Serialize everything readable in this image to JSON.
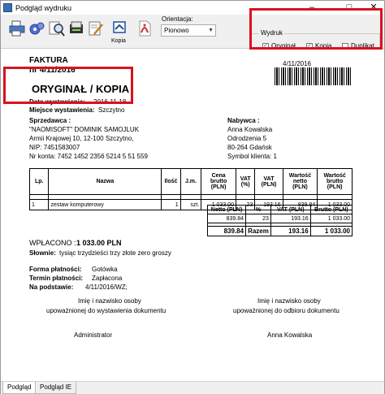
{
  "window": {
    "title": "Podgląd wydruku"
  },
  "toolbar": {
    "kopia_label": "Kopia",
    "orientation_label": "Orientacja:",
    "orientation_value": "Pionowo",
    "wydruk_legend": "Wydruk",
    "options": [
      {
        "label": "Oryginał",
        "checked": true
      },
      {
        "label": "Kopia",
        "checked": true
      },
      {
        "label": "Duplikat",
        "checked": false
      }
    ]
  },
  "invoice": {
    "doc_title": "FAKTURA",
    "number": "nr 4/11/2016",
    "barcode_text": "4/11/2016",
    "copy_type": "ORYGINAŁ / KOPIA",
    "issue_date_label": "Data wystawienia:",
    "issue_date_value": "2016-11-18",
    "place_label": "Miejsce wystawienia:",
    "place_value": "Szczytno",
    "seller_label": "Sprzedawca :",
    "seller_lines": [
      "\"NAOMISOFT\" DOMINIK SAMOJLUK",
      "Armii Krajowej 10, 12-100 Szczytno,",
      "NIP: 7451583007",
      "Nr konta: 7452 1452 2356 5214 5 51 559"
    ],
    "buyer_label": "Nabywca :",
    "buyer_lines": [
      "Anna Kowalska",
      "Odrodzenia 5",
      "80-264 Gdańsk",
      "Symbol klienta: 1"
    ],
    "table_headers": [
      "Lp.",
      "Nazwa",
      "Ilość",
      "J.m.",
      "Cena brutto (PLN)",
      "VAT (%)",
      "VAT (PLN)",
      "Wartość netto (PLN)",
      "Wartość brutto (PLN)"
    ],
    "items": [
      [
        "1",
        "zestaw komputerowy",
        "1",
        "szt.",
        "1 033.00",
        "23",
        "193.16",
        "839.84",
        "1 033.00"
      ]
    ],
    "summary_headers": [
      "Netto (PLN)",
      "%",
      "VAT (PLN)",
      "Brutto (PLN)"
    ],
    "summary_rows": [
      [
        "839.84",
        "23",
        "193.16",
        "1 033.00"
      ]
    ],
    "summary_total": [
      "839.84",
      "Razem",
      "193.16",
      "1 033.00"
    ],
    "paid_label": "WPŁACONO :",
    "paid_value": "1 033.00 PLN",
    "words_label": "Słownie:",
    "words_value": "tysiąc trzydzieści trzy złote zero groszy",
    "payment_form_label": "Forma płatności:",
    "payment_form_value": "Gotówka",
    "payment_term_label": "Termin płatności:",
    "payment_term_value": "Zapłacona",
    "basis_label": "Na podstawie:",
    "basis_value": "4/11/2016/WZ;",
    "sig_left_1": "Imię i nazwisko osoby",
    "sig_left_2": "upoważnionej do wystawienia dokumentu",
    "sig_right_1": "Imię i nazwisko osoby",
    "sig_right_2": "upoważnionej do odbioru dokumentu",
    "sig_left_name": "Administrator",
    "sig_right_name": "Anna Kowalska"
  },
  "tabs": [
    {
      "label": "Podgląd",
      "active": true
    },
    {
      "label": "Podgląd IE",
      "active": false
    }
  ],
  "colors": {
    "highlight": "#d9121f",
    "pdf": "#c8262b"
  }
}
